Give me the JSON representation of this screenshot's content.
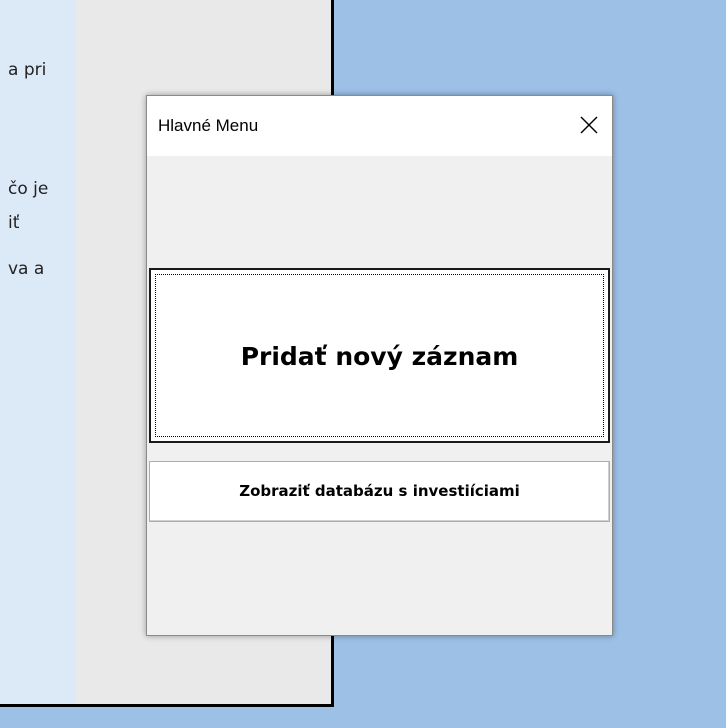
{
  "background_document": {
    "lines": [
      "a pri",
      "čo je",
      "iť",
      "va a"
    ]
  },
  "dialog": {
    "title": "Hlavné Menu",
    "close_icon": "close-icon",
    "buttons": {
      "add_record": "Pridať nový záznam",
      "show_database": "Zobraziť databázu s investiíciami"
    }
  },
  "colors": {
    "desktop_background": "#9dc0e6",
    "dialog_background": "#f0f0f0",
    "titlebar": "#ffffff"
  }
}
